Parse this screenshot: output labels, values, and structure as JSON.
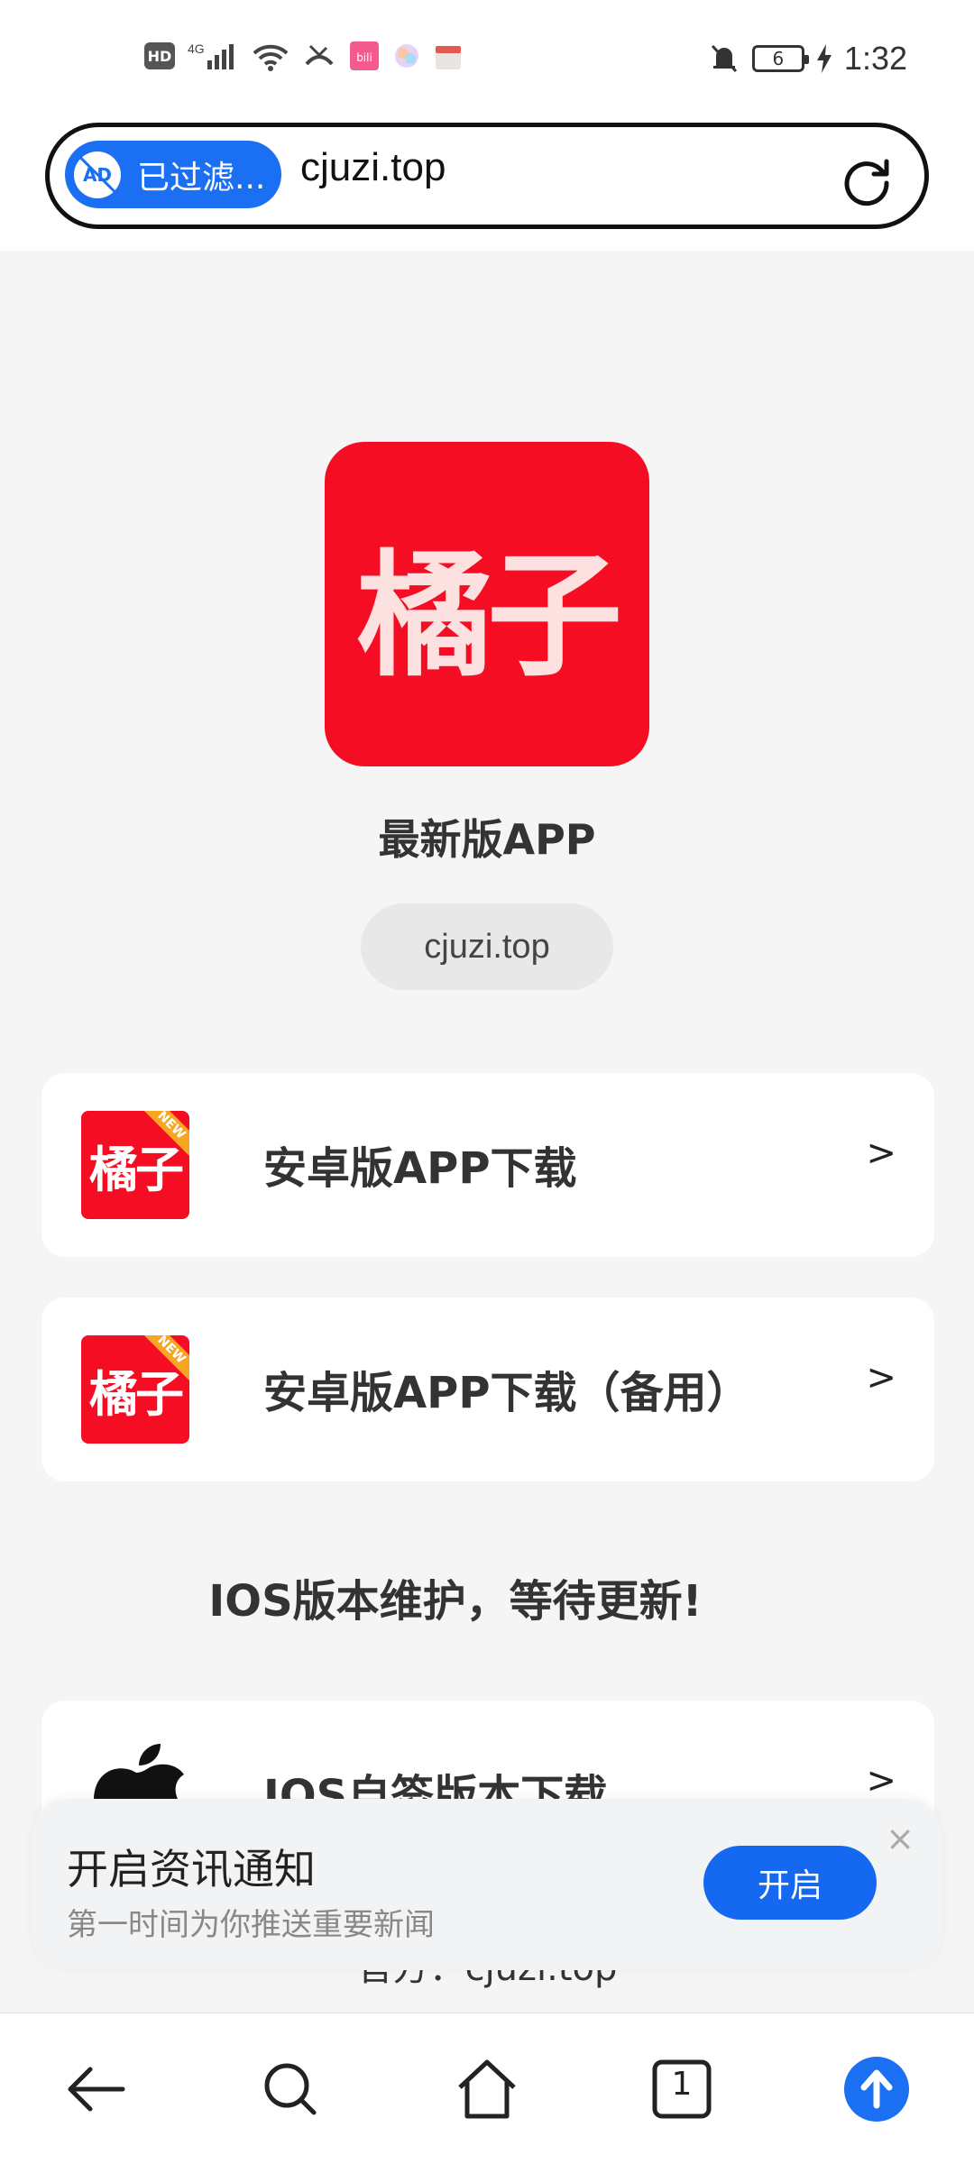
{
  "status_bar": {
    "left_badge": "HD",
    "network": "4G",
    "battery_level": "6",
    "time": "1:32"
  },
  "browser": {
    "ad_filter_label": "已过滤...",
    "ad_icon_text": "AD",
    "url": "cjuzi.top"
  },
  "hero": {
    "logo_text": "橘子",
    "title": "最新版APP",
    "domain": "cjuzi.top"
  },
  "downloads": [
    {
      "icon_text": "橘子",
      "ribbon": "NEW",
      "label": "安卓版APP下载",
      "arrow": ">"
    },
    {
      "icon_text": "橘子",
      "ribbon": "NEW",
      "label": "安卓版APP下载（备用）",
      "arrow": ">"
    },
    {
      "label": "IOS自签版本下载",
      "arrow": ">"
    }
  ],
  "ios_notice": "IOS版本维护，等待更新!",
  "footer_partial": "官方：cjuzi.top",
  "notification": {
    "title": "开启资讯通知",
    "subtitle": "第一时间为你推送重要新闻",
    "button": "开启",
    "close": "×"
  },
  "bottom_nav": {
    "tab_count": "1"
  },
  "colors": {
    "brand_red": "#f50d24",
    "accent_blue": "#1a6ff2"
  }
}
